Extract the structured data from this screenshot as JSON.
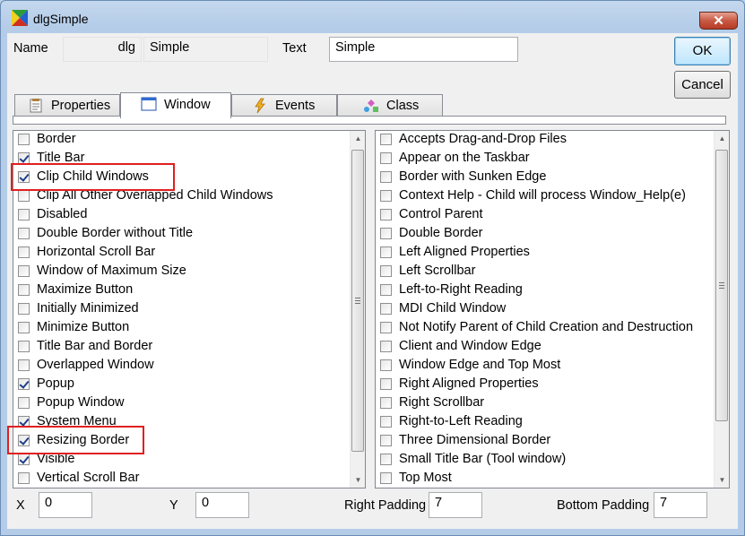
{
  "window": {
    "title": "dlgSimple",
    "close_glyph": "✕"
  },
  "form": {
    "name_label": "Name",
    "name_prefix": "dlg",
    "name_value": "Simple",
    "text_label": "Text",
    "text_value": "Simple",
    "ok_label": "OK",
    "cancel_label": "Cancel"
  },
  "tabs": [
    {
      "label": "Properties",
      "icon": "properties-icon"
    },
    {
      "label": "Window",
      "icon": "window-icon"
    },
    {
      "label": "Events",
      "icon": "lightning-icon"
    },
    {
      "label": "Class",
      "icon": "class-icon"
    }
  ],
  "active_tab": "Window",
  "left_list": [
    {
      "label": "Border",
      "checked": false
    },
    {
      "label": "Title Bar",
      "checked": true
    },
    {
      "label": "Clip Child Windows",
      "checked": true
    },
    {
      "label": "Clip All Other Overlapped Child Windows",
      "checked": false
    },
    {
      "label": "Disabled",
      "checked": false
    },
    {
      "label": "Double Border without Title",
      "checked": false
    },
    {
      "label": "Horizontal Scroll Bar",
      "checked": false
    },
    {
      "label": "Window of Maximum Size",
      "checked": false
    },
    {
      "label": "Maximize Button",
      "checked": false
    },
    {
      "label": "Initially Minimized",
      "checked": false
    },
    {
      "label": "Minimize Button",
      "checked": false
    },
    {
      "label": "Title Bar and Border",
      "checked": false
    },
    {
      "label": "Overlapped Window",
      "checked": false
    },
    {
      "label": "Popup",
      "checked": true
    },
    {
      "label": "Popup Window",
      "checked": false
    },
    {
      "label": "System Menu",
      "checked": true
    },
    {
      "label": "Resizing Border",
      "checked": true
    },
    {
      "label": "Visible",
      "checked": true
    },
    {
      "label": "Vertical Scroll Bar",
      "checked": false
    }
  ],
  "right_list": [
    {
      "label": "Accepts Drag-and-Drop Files",
      "checked": false
    },
    {
      "label": "Appear on the Taskbar",
      "checked": false
    },
    {
      "label": "Border with Sunken Edge",
      "checked": false
    },
    {
      "label": "Context Help - Child will process Window_Help(e)",
      "checked": false
    },
    {
      "label": "Control Parent",
      "checked": false
    },
    {
      "label": "Double Border",
      "checked": false
    },
    {
      "label": "Left Aligned Properties",
      "checked": false
    },
    {
      "label": "Left Scrollbar",
      "checked": false
    },
    {
      "label": "Left-to-Right Reading",
      "checked": false
    },
    {
      "label": "MDI Child Window",
      "checked": false
    },
    {
      "label": "Not Notify Parent of Child Creation and Destruction",
      "checked": false
    },
    {
      "label": "Client and Window Edge",
      "checked": false
    },
    {
      "label": "Window Edge and Top Most",
      "checked": false
    },
    {
      "label": "Right Aligned Properties",
      "checked": false
    },
    {
      "label": "Right Scrollbar",
      "checked": false
    },
    {
      "label": "Right-to-Left Reading",
      "checked": false
    },
    {
      "label": "Three Dimensional Border",
      "checked": false
    },
    {
      "label": "Small Title Bar (Tool window)",
      "checked": false
    },
    {
      "label": "Top Most",
      "checked": false
    }
  ],
  "highlights": [
    "Clip Child Windows",
    "Resizing Border"
  ],
  "bottom": {
    "x_label": "X",
    "x_value": "0",
    "y_label": "Y",
    "y_value": "0",
    "right_padding_label": "Right Padding",
    "right_padding_value": "7",
    "bottom_padding_label": "Bottom Padding",
    "bottom_padding_value": "7"
  },
  "colors": {
    "highlight": "#e02020",
    "title_bg": "#b9d1ea"
  }
}
